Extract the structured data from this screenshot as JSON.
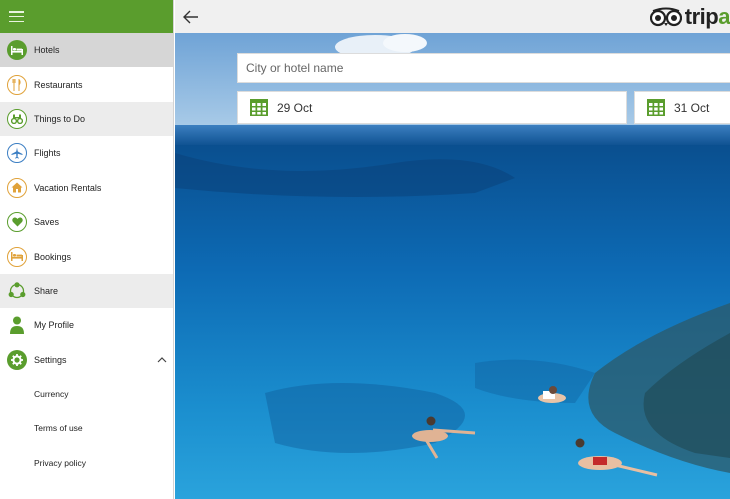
{
  "sidebar": {
    "items": [
      {
        "label": "Hotels",
        "icon": "hotel-bed-icon"
      },
      {
        "label": "Restaurants",
        "icon": "fork-knife-icon"
      },
      {
        "label": "Things to Do",
        "icon": "binoculars-icon"
      },
      {
        "label": "Flights",
        "icon": "airplane-icon"
      },
      {
        "label": "Vacation Rentals",
        "icon": "house-icon"
      },
      {
        "label": "Saves",
        "icon": "heart-icon"
      },
      {
        "label": "Bookings",
        "icon": "bed-icon"
      },
      {
        "label": "Share",
        "icon": "share-icon"
      },
      {
        "label": "My Profile",
        "icon": "person-icon"
      },
      {
        "label": "Settings",
        "icon": "gear-icon"
      }
    ],
    "settings_sub": [
      "Currency",
      "Terms of use",
      "Privacy policy"
    ]
  },
  "topbar": {
    "logo_text_main": "trip",
    "logo_text_accent": "a"
  },
  "search": {
    "placeholder": "City or hotel name",
    "checkin": "29 Oct",
    "checkout": "31 Oct"
  },
  "colors": {
    "brand_green": "#5a9d2d",
    "accent_orange": "#e0a23a"
  }
}
